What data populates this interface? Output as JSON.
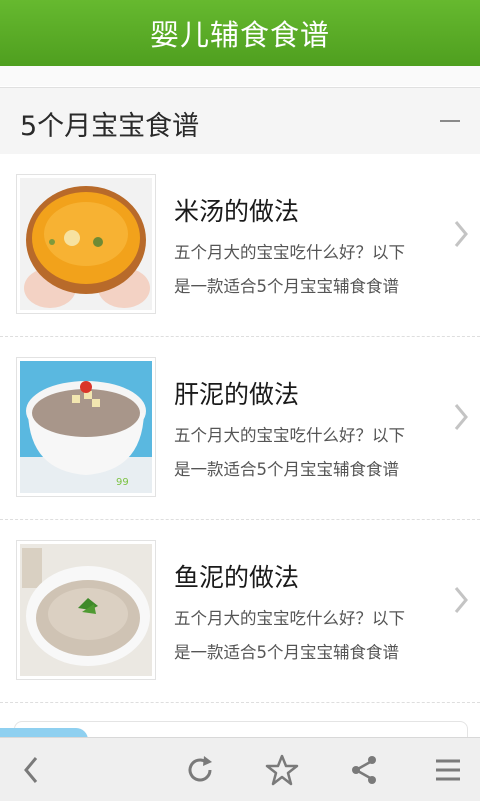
{
  "header": {
    "title": "婴儿辅食食谱"
  },
  "section": {
    "title": "5个月宝宝食谱"
  },
  "recipes": [
    {
      "name": "米汤的做法",
      "desc": "五个月大的宝宝吃什么好？以下\n是一款适合5个月宝宝辅食食谱",
      "image": "orange-rice-soup-bowl"
    },
    {
      "name": "肝泥的做法",
      "desc": "五个月大的宝宝吃什么好？以下\n是一款适合5个月宝宝辅食食谱",
      "image": "liver-puree-bowl"
    },
    {
      "name": "鱼泥的做法",
      "desc": "五个月大的宝宝吃什么好？以下\n是一款适合5个月宝宝辅食食谱",
      "image": "fish-puree-bowl"
    }
  ],
  "toolbar": {
    "buttons": [
      "back-icon",
      "refresh-icon",
      "star-icon",
      "share-icon",
      "menu-icon"
    ]
  },
  "colors": {
    "header": "#5aaf26",
    "toolbar": "#efefef",
    "icon": "#7a7a7a"
  }
}
